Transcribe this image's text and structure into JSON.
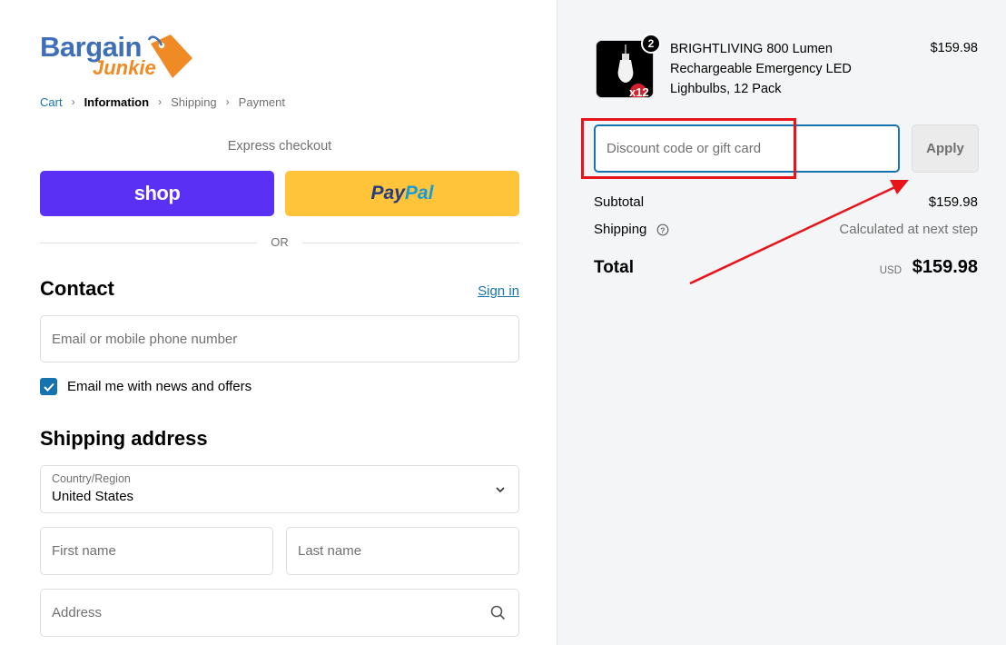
{
  "brand": {
    "line1": "Bargain",
    "line2": "Junkie"
  },
  "breadcrumb": [
    "Cart",
    "Information",
    "Shipping",
    "Payment"
  ],
  "express": {
    "label": "Express checkout",
    "shop_label": "shop",
    "paypal_part1": "Pay",
    "paypal_part2": "Pal",
    "or": "OR"
  },
  "contact": {
    "title": "Contact",
    "signin": "Sign in",
    "email_placeholder": "Email or mobile phone number",
    "newsletter_label": "Email me with news and offers",
    "newsletter_checked": true
  },
  "shipping": {
    "title": "Shipping address",
    "country_label": "Country/Region",
    "country_value": "United States",
    "first_name_placeholder": "First name",
    "last_name_placeholder": "Last name",
    "address_placeholder": "Address"
  },
  "order": {
    "item": {
      "name": "BRIGHTLIVING 800 Lumen Rechargeable Emergency LED Lighbulbs, 12 Pack",
      "price": "$159.98",
      "quantity": "2",
      "thumb_badge": "x12"
    },
    "discount_placeholder": "Discount code or gift card",
    "apply_label": "Apply",
    "subtotal_label": "Subtotal",
    "subtotal_value": "$159.98",
    "shipping_label": "Shipping",
    "shipping_value": "Calculated at next step",
    "total_label": "Total",
    "total_currency": "USD",
    "total_value": "$159.98"
  },
  "colors": {
    "accent": "#1773b0",
    "shop_purple": "#5a31f4",
    "paypal_yellow": "#ffc439",
    "brand_blue": "#3f6fb6",
    "brand_orange": "#f08a24",
    "annotation_red": "#e8141b"
  },
  "icons": [
    "shopping-tag-icon",
    "chevron-right-icon",
    "checkmark-icon",
    "chevron-down-icon",
    "search-icon",
    "help-circle-icon",
    "lightbulb-icon",
    "annotation-arrow"
  ]
}
